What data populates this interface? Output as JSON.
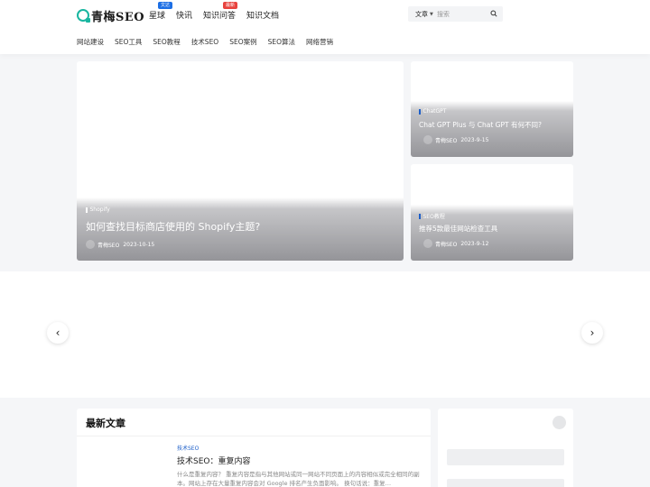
{
  "brand": {
    "logo_text": "青梅SEO",
    "accent": "#19b6a0"
  },
  "topnav": [
    {
      "label": "星球",
      "badge": "文达",
      "badge_color": "#1d6fe5"
    },
    {
      "label": "快讯",
      "badge": "",
      "badge_color": ""
    },
    {
      "label": "知识问答",
      "badge": "最新",
      "badge_color": "#e8433e"
    },
    {
      "label": "知识文档",
      "badge": "",
      "badge_color": ""
    }
  ],
  "search": {
    "type_label": "文章",
    "placeholder": "搜索"
  },
  "subnav": [
    "网站建设",
    "SEO工具",
    "SEO教程",
    "技术SEO",
    "SEO案例",
    "SEO算法",
    "网络营销"
  ],
  "hero": {
    "main": {
      "category": "Shopify",
      "title": "如何查找目标商店使用的 Shopify主题?",
      "author": "青梅SEO",
      "date": "2023-10-15"
    },
    "side": [
      {
        "category": "ChatGPT",
        "title": "Chat GPT Plus 与 Chat GPT 有何不同?",
        "author": "青梅SEO",
        "date": "2023-9-15"
      },
      {
        "category": "SEO教程",
        "title": "推荐5款最佳网站检查工具",
        "author": "青梅SEO",
        "date": "2023-9-12"
      }
    ]
  },
  "banner": {
    "prev_icon": "‹",
    "next_icon": "›"
  },
  "latest": {
    "heading": "最新文章",
    "articles": [
      {
        "category": "技术SEO",
        "title": "技术SEO：重复内容",
        "excerpt": "什么是重复内容？ 重复内容是指与其他网站或同一网站不同页面上的内容相似或完全相同的副本。网站上存在大量重复内容会对 Google 排名产生负面影响。 换句话说：重复…"
      }
    ]
  }
}
